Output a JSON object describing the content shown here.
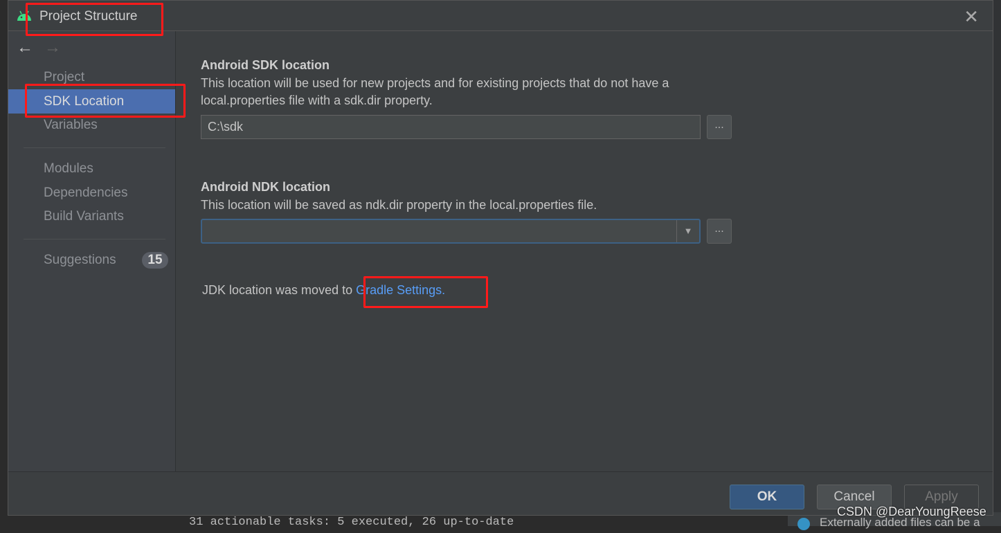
{
  "window": {
    "title": "Project Structure",
    "close_icon": "close-icon",
    "app_icon": "android-icon"
  },
  "sidebar": {
    "items": [
      {
        "label": "Project"
      },
      {
        "label": "SDK Location",
        "selected": true
      },
      {
        "label": "Variables"
      },
      {
        "label": "Modules"
      },
      {
        "label": "Dependencies"
      },
      {
        "label": "Build Variants"
      },
      {
        "label": "Suggestions",
        "badge": "15"
      }
    ]
  },
  "sdk": {
    "heading": "Android SDK location",
    "desc1": "This location will be used for new projects and for existing projects that do not have a",
    "desc2": "local.properties file with a sdk.dir property.",
    "value": "C:\\sdk",
    "browse": "..."
  },
  "ndk": {
    "heading": "Android NDK location",
    "desc": "This location will be saved as ndk.dir property in the local.properties file.",
    "value": "",
    "browse": "..."
  },
  "jdk": {
    "text": "JDK location was moved to ",
    "link": "Gradle Settings."
  },
  "buttons": {
    "ok": "OK",
    "cancel": "Cancel",
    "apply": "Apply"
  },
  "background": {
    "console": "31 actionable tasks: 5 executed, 26 up-to-date",
    "notification": "Externally added files can be a"
  },
  "watermark": "CSDN @DearYoungReese",
  "colors": {
    "accent": "#4b6eaf",
    "link": "#589df6",
    "annotation": "#ff1a1a"
  }
}
